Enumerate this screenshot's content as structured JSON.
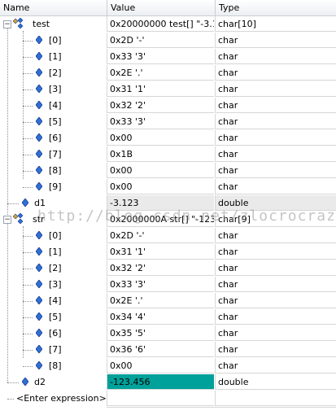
{
  "header": {
    "name": "Name",
    "value": "Value",
    "type": "Type"
  },
  "rows": [
    {
      "name": "test",
      "value": "0x20000000 test[] \"-3.1...",
      "type": "char[10]",
      "kind": "array",
      "expanded": true
    },
    {
      "name": "[0]",
      "value": "0x2D '-'",
      "type": "char",
      "kind": "elem"
    },
    {
      "name": "[1]",
      "value": "0x33 '3'",
      "type": "char",
      "kind": "elem"
    },
    {
      "name": "[2]",
      "value": "0x2E '.'",
      "type": "char",
      "kind": "elem"
    },
    {
      "name": "[3]",
      "value": "0x31 '1'",
      "type": "char",
      "kind": "elem"
    },
    {
      "name": "[4]",
      "value": "0x32 '2'",
      "type": "char",
      "kind": "elem"
    },
    {
      "name": "[5]",
      "value": "0x33 '3'",
      "type": "char",
      "kind": "elem"
    },
    {
      "name": "[6]",
      "value": "0x00",
      "type": "char",
      "kind": "elem"
    },
    {
      "name": "[7]",
      "value": "0x1B",
      "type": "char",
      "kind": "elem"
    },
    {
      "name": "[8]",
      "value": "0x00",
      "type": "char",
      "kind": "elem"
    },
    {
      "name": "[9]",
      "value": "0x00",
      "type": "char",
      "kind": "elem"
    },
    {
      "name": "d1",
      "value": "-3.123",
      "type": "double",
      "kind": "scalar",
      "selected": true
    },
    {
      "name": "str",
      "value": "0x2000000A str[] \"-123...",
      "type": "char[9]",
      "kind": "array",
      "expanded": true
    },
    {
      "name": "[0]",
      "value": "0x2D '-'",
      "type": "char",
      "kind": "elem"
    },
    {
      "name": "[1]",
      "value": "0x31 '1'",
      "type": "char",
      "kind": "elem"
    },
    {
      "name": "[2]",
      "value": "0x32 '2'",
      "type": "char",
      "kind": "elem"
    },
    {
      "name": "[3]",
      "value": "0x33 '3'",
      "type": "char",
      "kind": "elem"
    },
    {
      "name": "[4]",
      "value": "0x2E '.'",
      "type": "char",
      "kind": "elem"
    },
    {
      "name": "[5]",
      "value": "0x34 '4'",
      "type": "char",
      "kind": "elem"
    },
    {
      "name": "[6]",
      "value": "0x35 '5'",
      "type": "char",
      "kind": "elem"
    },
    {
      "name": "[7]",
      "value": "0x36 '6'",
      "type": "char",
      "kind": "elem"
    },
    {
      "name": "[8]",
      "value": "0x00",
      "type": "char",
      "kind": "elem"
    },
    {
      "name": "d2",
      "value": "-123.456",
      "type": "double",
      "kind": "scalar",
      "highlighted": true
    },
    {
      "name": "<Enter expression>",
      "value": "",
      "type": "",
      "kind": "expr"
    }
  ],
  "watermark": "http://blog.csdn.net/zlocrocrazy",
  "colors": {
    "highlight": "#00a19a",
    "icon_blue": "#2f6fd6",
    "icon_dark": "#1b3f8f",
    "icon_gold": "#d8a326"
  },
  "icons": {
    "expander": "minus-box-icon",
    "scalar": "blue-diamond-variable-icon",
    "array": "struct-array-icon"
  }
}
